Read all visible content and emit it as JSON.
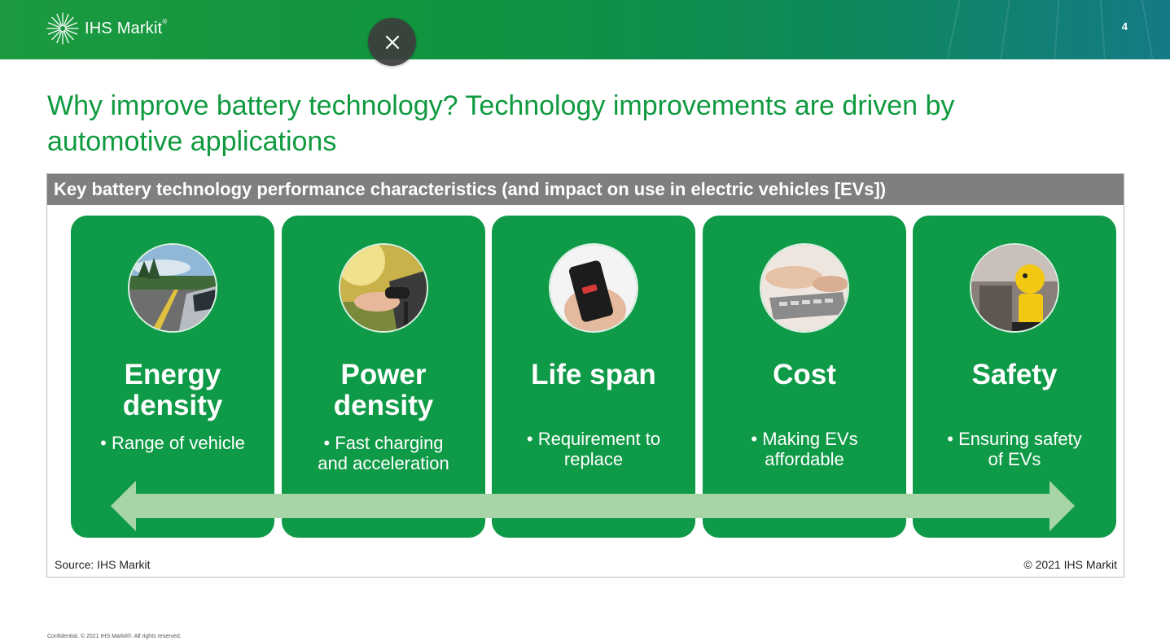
{
  "header": {
    "brand": "IHS Markit",
    "brand_mark": "®",
    "page_number": "4",
    "colors": {
      "bar_start": "#1b9a3f",
      "bar_end": "#147a86"
    }
  },
  "overlay": {
    "close_icon": "×"
  },
  "slide": {
    "title_line1": "Why improve battery technology? Technology improvements are driven by",
    "title_line2": "automotive applications",
    "title_color": "#109a3f"
  },
  "figure": {
    "header": "Key battery technology performance characteristics (and impact on use in electric vehicles [EVs])",
    "card_color": "#0f9a47",
    "arrow_color": "#a8d5a8",
    "cards": [
      {
        "heading_line1": "Energy",
        "heading_line2": "density",
        "bullet_line1": "• Range of vehicle",
        "bullet_line2": "",
        "image": "road-car-photo"
      },
      {
        "heading_line1": "Power",
        "heading_line2": "density",
        "bullet_line1": "• Fast charging",
        "bullet_line2": "and acceleration",
        "image": "ev-charging-photo"
      },
      {
        "heading_line1": "Life span",
        "heading_line2": "",
        "bullet_line1": "• Requirement to",
        "bullet_line2": "replace",
        "image": "phone-battery-photo"
      },
      {
        "heading_line1": "Cost",
        "heading_line2": "",
        "bullet_line1": "• Making EVs",
        "bullet_line2": "affordable",
        "image": "calculator-photo"
      },
      {
        "heading_line1": "Safety",
        "heading_line2": "",
        "bullet_line1": "• Ensuring safety",
        "bullet_line2": "of EVs",
        "image": "crash-test-dummy-photo"
      }
    ],
    "source": "Source: IHS Markit",
    "copyright": "© 2021 IHS Markit"
  },
  "footer": {
    "text": "Confidential. © 2021 IHS Markit®. All rights reserved."
  }
}
